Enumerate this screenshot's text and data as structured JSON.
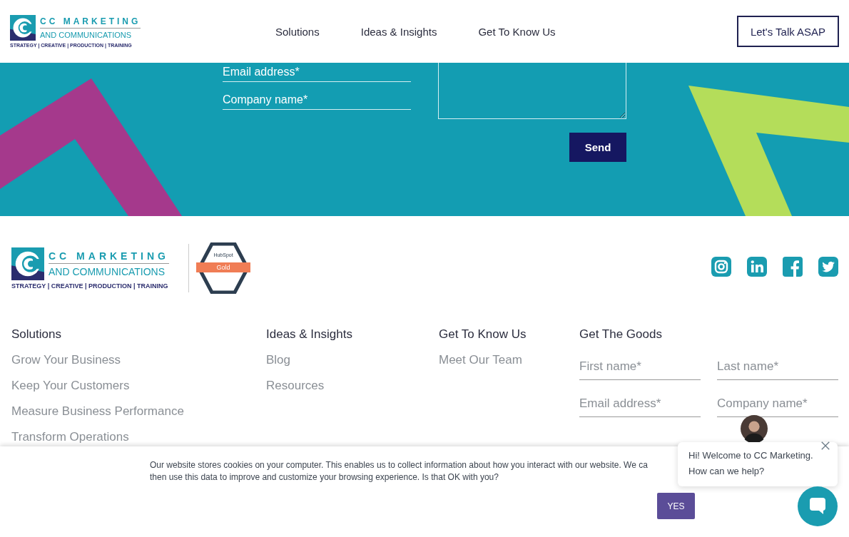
{
  "header": {
    "logo": {
      "name": "CC MARKETING",
      "subname": "AND COMMUNICATIONS",
      "tagline": "STRATEGY | CREATIVE | PRODUCTION | TRAINING"
    },
    "nav": [
      "Solutions",
      "Ideas & Insights",
      "Get To Know Us"
    ],
    "cta": "Let's Talk ASAP"
  },
  "contact_form": {
    "fields": [
      {
        "placeholder": "Email address*"
      },
      {
        "placeholder": "Company name*"
      }
    ],
    "send": "Send"
  },
  "footer": {
    "logo": {
      "name": "CC MARKETING",
      "subname": "AND COMMUNICATIONS",
      "tagline": "STRATEGY | CREATIVE | PRODUCTION | TRAINING"
    },
    "badge": {
      "brand": "HubSpot",
      "tier": "Gold"
    },
    "social": [
      {
        "kind": "instagram"
      },
      {
        "kind": "linkedin"
      },
      {
        "kind": "facebook"
      },
      {
        "kind": "twitter"
      }
    ],
    "columns": [
      {
        "heading": "Solutions",
        "links": [
          "Grow Your Business",
          "Keep Your Customers",
          "Measure Business Performance",
          "Transform Operations"
        ]
      },
      {
        "heading": "Ideas & Insights",
        "links": [
          "Blog",
          "Resources"
        ]
      },
      {
        "heading": "Get To Know Us",
        "links": [
          "Meet Our Team"
        ]
      }
    ],
    "signup": {
      "heading": "Get The Goods",
      "fields": [
        {
          "placeholder": "First name*"
        },
        {
          "placeholder": "Last name*"
        },
        {
          "placeholder": "Email address*"
        },
        {
          "placeholder": "Company name*"
        }
      ]
    }
  },
  "cookie_banner": {
    "lines": [
      "Our website stores cookies on your computer. This enables us to collect information about how you interact with our website. We ca",
      "then use this data to improve and customize your browsing experience. Is that OK with you?"
    ],
    "button": "YES"
  },
  "chat": {
    "message_lines": [
      "Hi! Welcome to CC Marketing.",
      "How can we help?"
    ]
  }
}
